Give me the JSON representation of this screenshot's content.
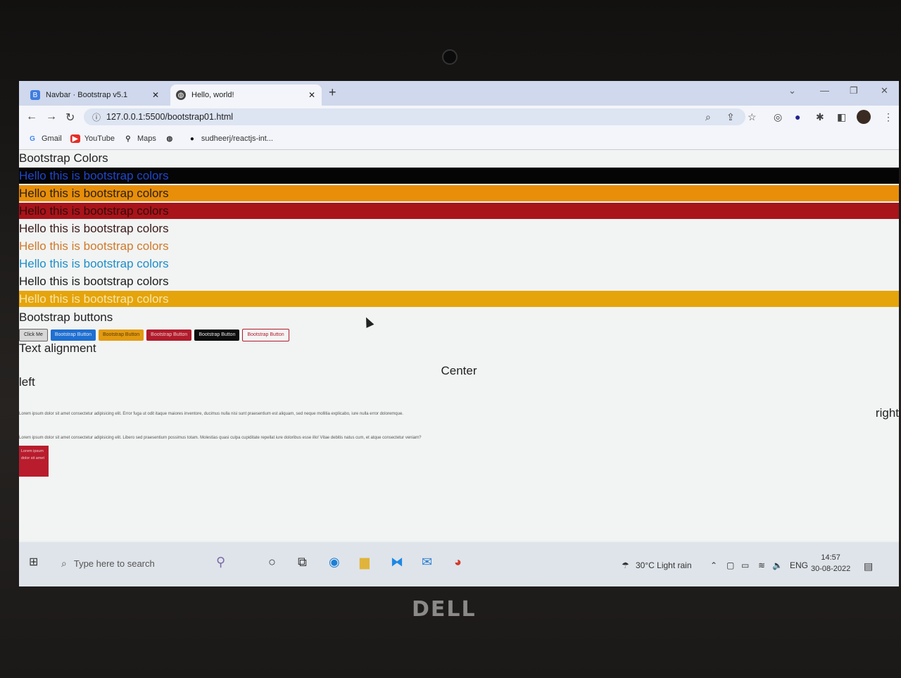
{
  "browser": {
    "tabs": [
      {
        "label": "Navbar · Bootstrap v5.1",
        "icon": "bootstrap-icon",
        "active": false
      },
      {
        "label": "Hello, world!",
        "icon": "globe-icon",
        "active": true
      }
    ],
    "url": "127.0.0.1:5500/bootstrap01.html",
    "bookmarks": [
      {
        "label": "Gmail",
        "icon": "google-icon"
      },
      {
        "label": "YouTube",
        "icon": "youtube-icon"
      },
      {
        "label": "Maps",
        "icon": "maps-pin-icon"
      },
      {
        "label": "",
        "icon": "globe-icon"
      },
      {
        "label": "sudheerj/reactjs-int...",
        "icon": "github-icon"
      }
    ]
  },
  "content": {
    "colors_heading": "Bootstrap Colors",
    "color_line": "Hello this is bootstrap colors",
    "buttons_heading": "Bootstrap buttons",
    "buttons": [
      "Click Me",
      "Bootstrap Button",
      "Bootstrap Button",
      "Bootstrap Button",
      "Bootstrap Button",
      "Bootstrap Button"
    ],
    "align_heading": "Text alignment",
    "center_text": "Center",
    "left_text": "left",
    "right_text": "right",
    "lorem1": "Lorem ipsum dolor sit amet consectetur adipisicing elit. Error fuga ut odit itaque maiores inventore, ducimus nulla nisi sunt praesentium est aliquam, sed neque mollitia explicabo, iure nulla error doloremque.",
    "lorem2": "Lorem ipsum dolor sit amet consectetur adipisicing elit. Libero sed praesentium possimus totam. Molestias quasi culpa cupiditate repellat iure doloribus esse illo! Vitae debitis natus cum, et atque consectetur veniam?",
    "box_text": "Lorem ipsum dolor sit amet"
  },
  "taskbar": {
    "search_placeholder": "Type here to search",
    "weather": "30°C  Light rain",
    "language": "ENG",
    "time": "14:57",
    "date": "30-08-2022"
  },
  "brand": "DELL",
  "colors": {
    "black_band": "#050505",
    "orange_band": "#e88e08",
    "red_band": "#a8141a",
    "yellow_band": "#e5a40c"
  }
}
